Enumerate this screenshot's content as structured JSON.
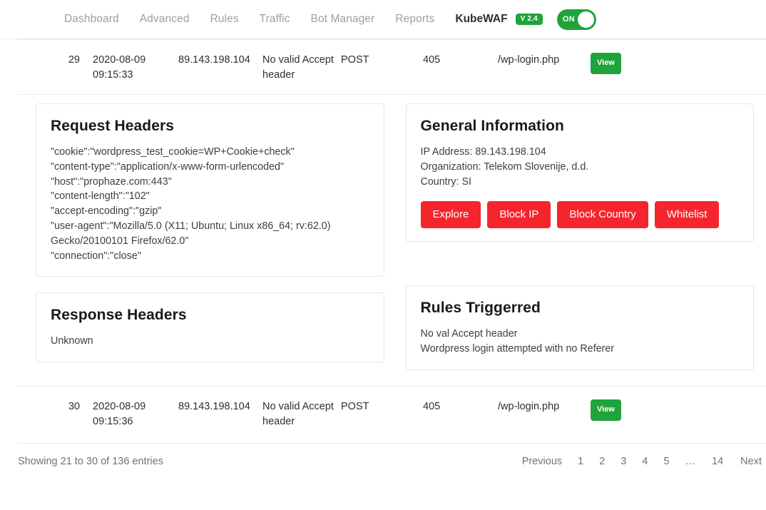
{
  "nav": {
    "links": [
      {
        "label": "Dashboard"
      },
      {
        "label": "Advanced"
      },
      {
        "label": "Rules"
      },
      {
        "label": "Traffic"
      },
      {
        "label": "Bot Manager"
      },
      {
        "label": "Reports"
      }
    ],
    "brand": "KubeWAF",
    "version_badge": "V 2.4",
    "toggle_state": "ON",
    "accent_green": "#1fa33a"
  },
  "rows": [
    {
      "id": "29",
      "date": "2020-08-09\n09:15:33",
      "ip": "89.143.198.104",
      "reason": "No valid Accept header",
      "method": "POST",
      "status": "405",
      "path": "/wp-login.php",
      "action_label": "View"
    },
    {
      "id": "30",
      "date": "2020-08-09\n09:15:36",
      "ip": "89.143.198.104",
      "reason": "No valid Accept header",
      "method": "POST",
      "status": "405",
      "path": "/wp-login.php",
      "action_label": "View"
    }
  ],
  "detail": {
    "request_headers": {
      "title": "Request Headers",
      "body": "\"cookie\":\"wordpress_test_cookie=WP+Cookie+check\"\n\"content-type\":\"application/x-www-form-urlencoded\"\n\"host\":\"prophaze.com:443\"\n\"content-length\":\"102\"\n\"accept-encoding\":\"gzip\"\n\"user-agent\":\"Mozilla/5.0 (X11; Ubuntu; Linux x86_64; rv:62.0) Gecko/20100101 Firefox/62.0\"\n\"connection\":\"close\""
    },
    "response_headers": {
      "title": "Response Headers",
      "body": "Unknown"
    },
    "general_information": {
      "title": "General Information",
      "ip_address": "IP Address: 89.143.198.104",
      "organization": "Organization: Telekom Slovenije, d.d.",
      "country": "Country: SI",
      "buttons": [
        {
          "label": "Explore"
        },
        {
          "label": "Block IP"
        },
        {
          "label": "Block Country"
        },
        {
          "label": "Whitelist"
        }
      ],
      "button_color": "#f5252d"
    },
    "rules_triggered": {
      "title": "Rules Triggerred",
      "rules": [
        "No val Accept header",
        "Wordpress login attempted with no Referer"
      ]
    }
  },
  "footer": {
    "showing": "Showing 21 to 30 of 136 entries",
    "pagination": [
      {
        "label": "Previous"
      },
      {
        "label": "1"
      },
      {
        "label": "2"
      },
      {
        "label": "3"
      },
      {
        "label": "4"
      },
      {
        "label": "5"
      },
      {
        "label": "…"
      },
      {
        "label": "14"
      },
      {
        "label": "Next"
      }
    ]
  }
}
